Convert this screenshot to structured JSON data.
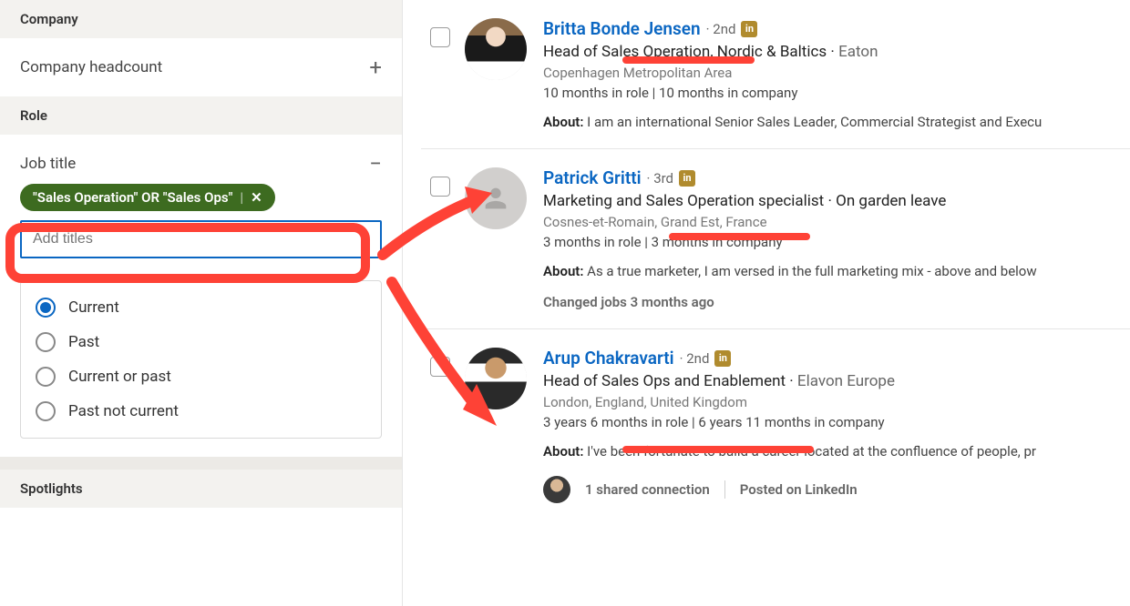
{
  "sidebar": {
    "company": {
      "header": "Company",
      "headcount_label": "Company headcount"
    },
    "role": {
      "header": "Role",
      "job_title_label": "Job title",
      "pill": "\"Sales Operation\" OR \"Sales Ops\"",
      "add_titles_placeholder": "Add titles",
      "radios": {
        "current": "Current",
        "past": "Past",
        "current_or_past": "Current or past",
        "past_not_current": "Past not current"
      }
    },
    "spotlights": {
      "header": "Spotlights"
    }
  },
  "results": [
    {
      "name": "Britta Bonde Jensen",
      "degree": "2nd",
      "headline_pre": "Head of ",
      "headline_match": "Sales Operation,",
      "headline_post": " Nordic & Baltics",
      "company": "Eaton",
      "location": "Copenhagen Metropolitan Area",
      "tenure": "10 months in role | 10 months in company",
      "about_label": "About:",
      "about": " I am an international Senior Sales Leader, Commercial Strategist and Execu"
    },
    {
      "name": "Patrick Gritti",
      "degree": "3rd",
      "headline_pre": "Marketing and ",
      "headline_match": "Sales Operation",
      "headline_post": " specialist",
      "company": "On garden leave",
      "location": "Cosnes-et-Romain, Grand Est, France",
      "tenure": "3 months in role | 3 months in company",
      "about_label": "About:",
      "about": " As a true marketer, I am versed in the full marketing mix - above and below",
      "changed_jobs": "Changed jobs 3 months ago"
    },
    {
      "name": "Arup Chakravarti",
      "degree": "2nd",
      "headline_pre": "Head of ",
      "headline_match": "Sales Ops",
      "headline_post": " and Enablement",
      "company": "Elavon Europe",
      "location": "London, England, United Kingdom",
      "tenure": "3 years 6 months in role | 6 years 11 months in company",
      "about_label": "About:",
      "about": " I've been fortunate to build a career located at the confluence of people, pr",
      "shared_connection": "1 shared connection",
      "posted": "Posted on LinkedIn"
    }
  ],
  "badge_text": "in"
}
